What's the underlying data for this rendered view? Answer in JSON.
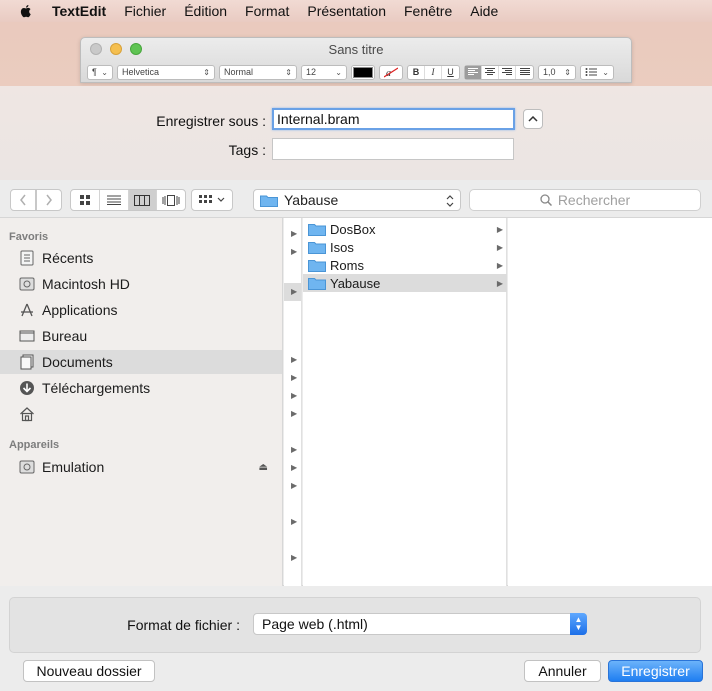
{
  "menubar": {
    "apple_icon": "apple-logo-icon",
    "app": "TextEdit",
    "items": [
      "Fichier",
      "Édition",
      "Format",
      "Présentation",
      "Fenêtre",
      "Aide"
    ]
  },
  "textedit_window": {
    "title": "Sans titre",
    "paragraph_style": "¶",
    "font_family": "Helvetica",
    "font_style": "Normal",
    "font_size": "12",
    "bold": "B",
    "italic": "I",
    "underline": "U",
    "spacing": "1,0"
  },
  "save_dialog": {
    "save_as_label": "Enregistrer sous :",
    "save_as_value": "Internal.bram",
    "tags_label": "Tags :",
    "tags_value": "",
    "location": "Yabause",
    "search_placeholder": "Rechercher"
  },
  "sidebar": {
    "favorites_header": "Favoris",
    "favorites": [
      {
        "label": "Récents",
        "icon": "recents-icon"
      },
      {
        "label": "Macintosh HD",
        "icon": "hard-drive-icon"
      },
      {
        "label": "Applications",
        "icon": "applications-icon"
      },
      {
        "label": "Bureau",
        "icon": "desktop-icon"
      },
      {
        "label": "Documents",
        "icon": "documents-icon"
      },
      {
        "label": "Téléchargements",
        "icon": "downloads-icon"
      },
      {
        "label": "",
        "icon": "home-icon"
      }
    ],
    "devices_header": "Appareils",
    "devices": [
      {
        "label": "Emulation",
        "icon": "disk-icon"
      }
    ]
  },
  "browser": {
    "column1": [
      "DosBox",
      "Isos",
      "Roms",
      "Yabause"
    ]
  },
  "bottom": {
    "format_label": "Format de fichier :",
    "format_value": "Page web (.html)",
    "new_folder": "Nouveau dossier",
    "cancel": "Annuler",
    "save": "Enregistrer"
  }
}
